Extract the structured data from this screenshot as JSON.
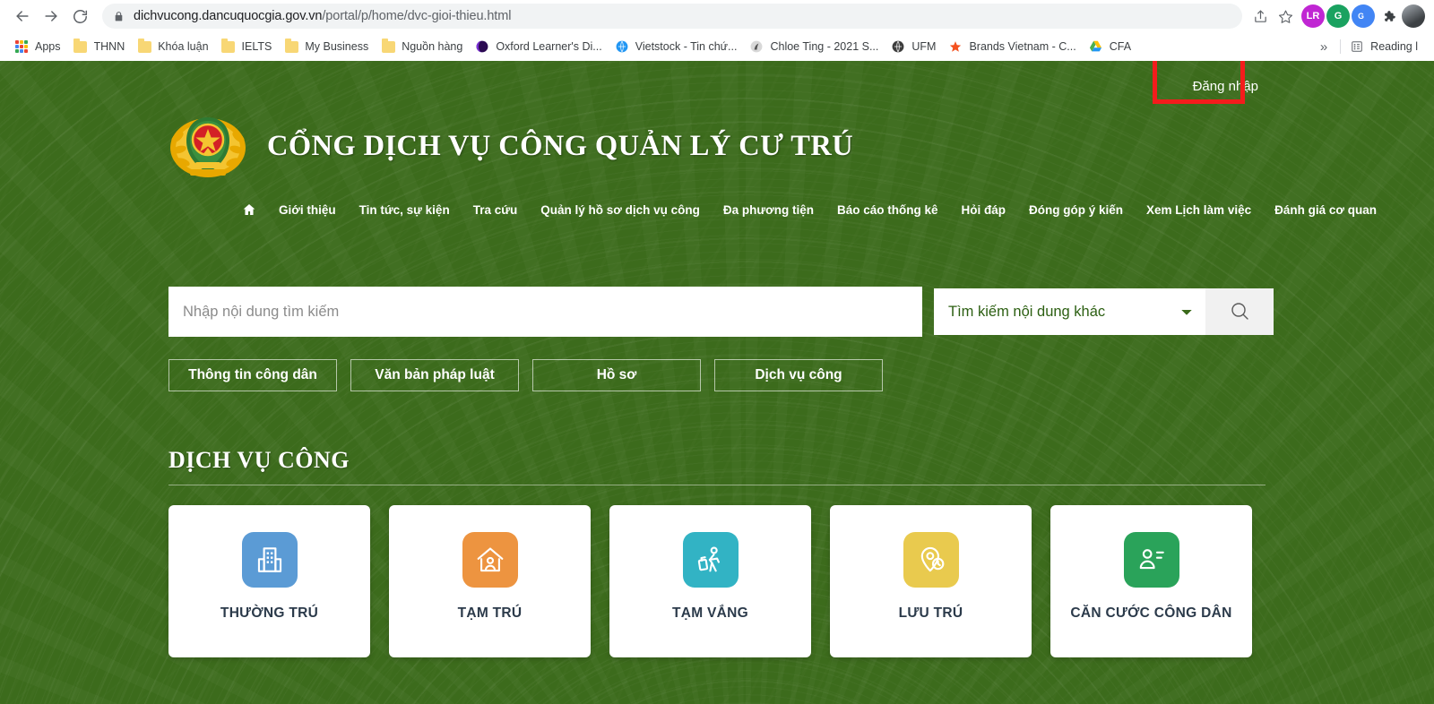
{
  "browser": {
    "back_icon": "back-arrow-icon",
    "forward_icon": "forward-arrow-icon",
    "reload_icon": "reload-icon",
    "lock_icon": "lock-icon",
    "url_domain": "dichvucong.dancuquocgia.gov.vn",
    "url_path": "/portal/p/home/dvc-gioi-thieu.html",
    "share_icon": "share-icon",
    "bookmark_icon": "star-icon",
    "extensions": [
      {
        "name": "lastpass-extension-icon",
        "label": "LR"
      },
      {
        "name": "grammarly-extension-icon",
        "label": "G"
      },
      {
        "name": "google-translate-extension-icon",
        "label": "G"
      },
      {
        "name": "extensions-puzzle-icon",
        "label": ""
      }
    ],
    "profile_avatar": "profile-avatar",
    "bookmarks": [
      {
        "label": "Apps",
        "icon": "apps-grid-icon"
      },
      {
        "label": "THNN",
        "icon": "folder-icon"
      },
      {
        "label": "Khóa luận",
        "icon": "folder-icon"
      },
      {
        "label": "IELTS",
        "icon": "folder-icon"
      },
      {
        "label": "My Business",
        "icon": "folder-icon"
      },
      {
        "label": "Nguồn hàng",
        "icon": "folder-icon"
      },
      {
        "label": "Oxford Learner's Di...",
        "icon": "site-icon"
      },
      {
        "label": "Vietstock - Tin chứ...",
        "icon": "site-icon"
      },
      {
        "label": "Chloe Ting - 2021 S...",
        "icon": "site-icon"
      },
      {
        "label": "UFM",
        "icon": "site-icon"
      },
      {
        "label": "Brands Vietnam - C...",
        "icon": "star-icon"
      },
      {
        "label": "CFA",
        "icon": "drive-icon"
      }
    ],
    "overflow_label": "»",
    "reading_list_label": "Reading l",
    "reading_list_icon": "reading-list-icon"
  },
  "header": {
    "login_label": "Đăng nhập",
    "emblem_icon": "vietnam-public-security-emblem",
    "site_title": "CỔNG DỊCH VỤ CÔNG QUẢN LÝ CƯ TRÚ",
    "highlight_color": "#f41c1c",
    "background_color": "#3c6b1c"
  },
  "nav": {
    "home_icon": "home-icon",
    "items": [
      {
        "label": "Giới thiệu"
      },
      {
        "label": "Tin tức, sự kiện"
      },
      {
        "label": "Tra cứu"
      },
      {
        "label": "Quản lý hồ sơ dịch vụ công"
      },
      {
        "label": "Đa phương tiện"
      },
      {
        "label": "Báo cáo thống kê"
      },
      {
        "label": "Hỏi đáp"
      },
      {
        "label": "Đóng góp ý kiến"
      },
      {
        "label": "Xem Lịch làm việc"
      },
      {
        "label": "Đánh giá cơ quan"
      }
    ]
  },
  "search": {
    "placeholder": "Nhập nội dung tìm kiếm",
    "value": "",
    "select_value": "Tìm kiếm nội dung khác",
    "select_options": [
      "Tìm kiếm nội dung khác"
    ],
    "search_icon": "search-icon",
    "chevron_icon": "chevron-down-icon"
  },
  "quick_links": [
    {
      "label": "Thông tin công dân"
    },
    {
      "label": "Văn bản pháp luật"
    },
    {
      "label": "Hồ sơ"
    },
    {
      "label": "Dịch vụ công"
    }
  ],
  "services_section": {
    "title": "DỊCH VỤ CÔNG",
    "cards": [
      {
        "label": "THƯỜNG TRÚ",
        "icon": "building-icon",
        "color": "#5b9bd5"
      },
      {
        "label": "TẠM TRÚ",
        "icon": "house-person-icon",
        "color": "#ed9440"
      },
      {
        "label": "TẠM VẮNG",
        "icon": "traveler-icon",
        "color": "#32b3c4"
      },
      {
        "label": "LƯU TRÚ",
        "icon": "pin-clock-icon",
        "color": "#e9ca4e"
      },
      {
        "label": "CĂN CƯỚC CÔNG DÂN",
        "icon": "id-card-icon",
        "color": "#2aa35a"
      }
    ]
  }
}
